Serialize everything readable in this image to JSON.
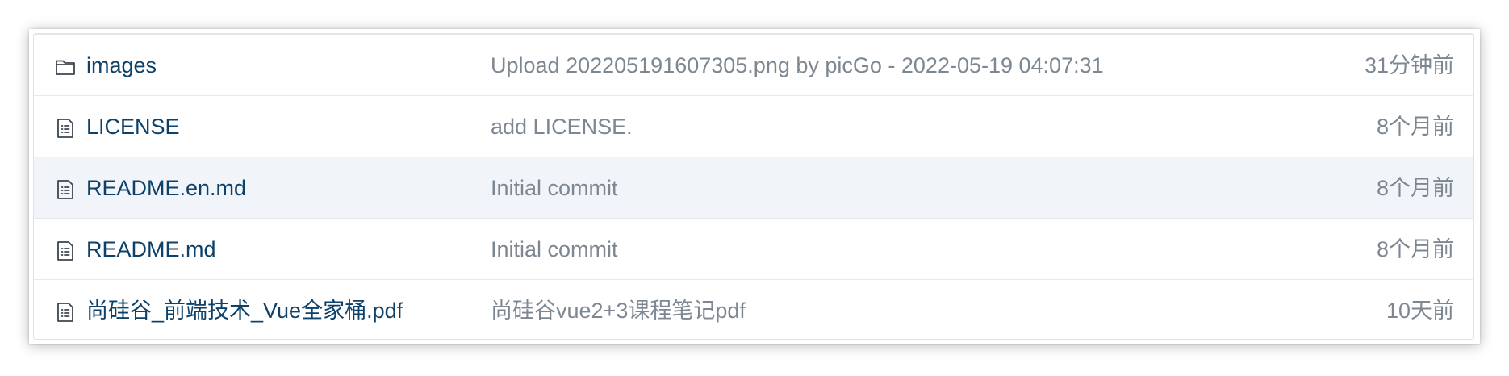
{
  "files": [
    {
      "name": "images",
      "icon": "folder-icon",
      "commit_message": "Upload 202205191607305.png by picGo - 2022-05-19 04:07:31",
      "time": "31分钟前"
    },
    {
      "name": "LICENSE",
      "icon": "file-icon",
      "commit_message": "add LICENSE.",
      "time": "8个月前"
    },
    {
      "name": "README.en.md",
      "icon": "file-icon",
      "commit_message": "Initial commit",
      "time": "8个月前"
    },
    {
      "name": "README.md",
      "icon": "file-icon",
      "commit_message": "Initial commit",
      "time": "8个月前"
    },
    {
      "name": "尚硅谷_前端技术_Vue全家桶.pdf",
      "icon": "file-icon",
      "commit_message": "尚硅谷vue2+3课程笔记pdf",
      "time": "10天前"
    }
  ],
  "colors": {
    "file_link": "#0d4169",
    "muted_text": "#7d8792",
    "row_hover": "#f1f5f9",
    "border": "#e6eaef"
  }
}
